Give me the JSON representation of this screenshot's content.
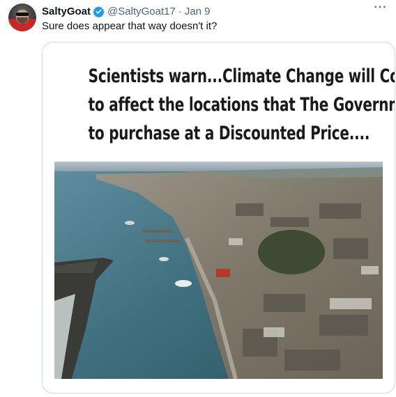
{
  "tweet": {
    "display_name": "SaltyGoat",
    "handle": "@SaltyGoat17",
    "separator": "·",
    "date": "Jan 9",
    "text": "Sure does appear that way doesn't it?",
    "more_label": "···"
  },
  "media": {
    "headline_lines": [
      "Scientists warn...Climate Change will Continue",
      "to affect the locations that The Government wants",
      "to purchase at a Discounted Price...."
    ],
    "photo_icon": "aerial-wildfire-destruction-photo"
  },
  "colors": {
    "verified": "#1d9bf0",
    "secondary_text": "#536471",
    "border": "#cfd9de"
  }
}
